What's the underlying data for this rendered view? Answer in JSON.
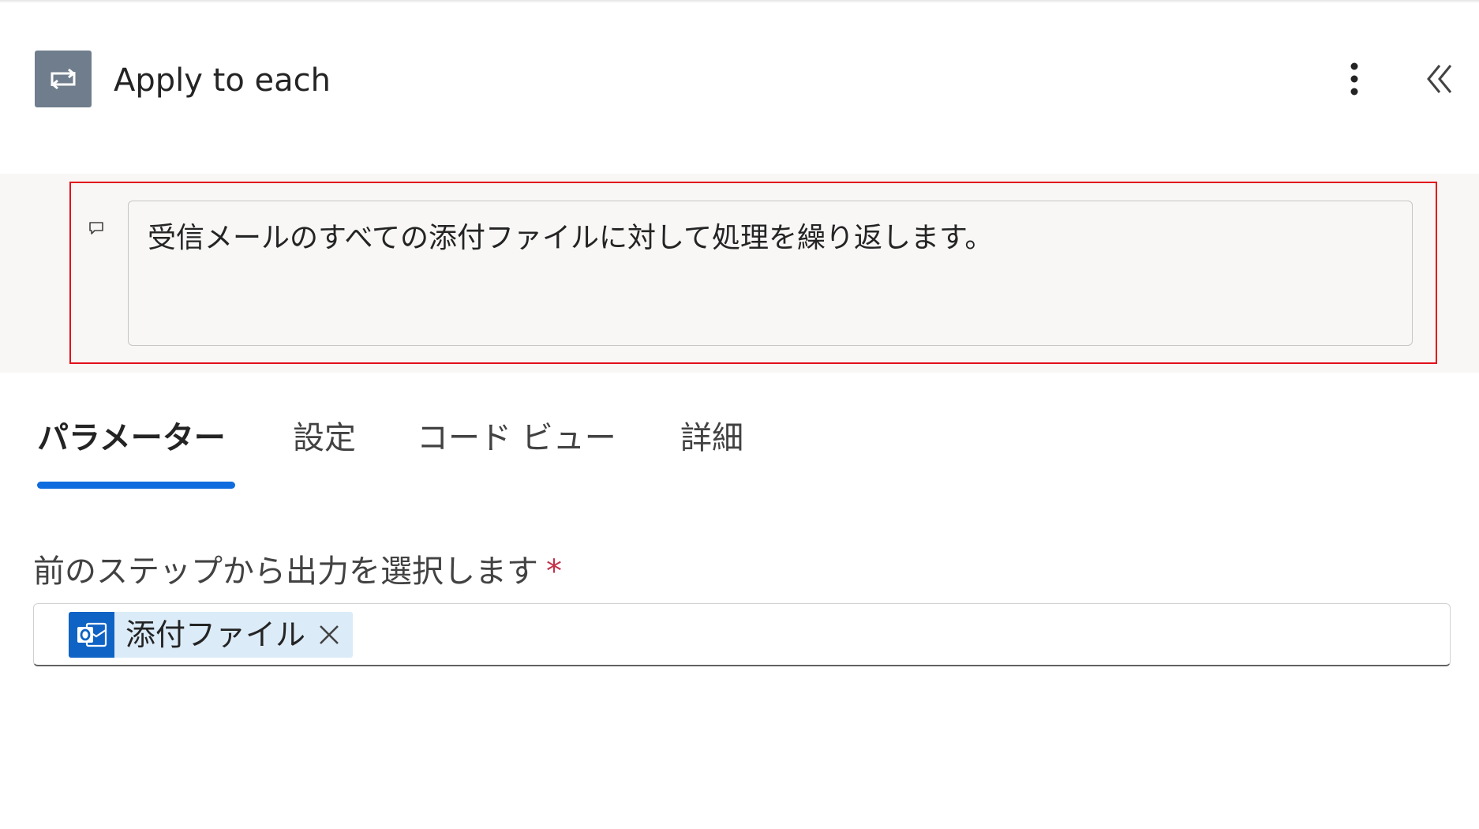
{
  "header": {
    "title": "Apply to each",
    "action_icon": "loop-icon",
    "more_icon": "more-vertical-icon",
    "collapse_icon": "double-chevron-left-icon"
  },
  "comment": {
    "icon": "comment-icon",
    "text": "受信メールのすべての添付ファイルに対して処理を繰り返します。"
  },
  "tabs": [
    {
      "label": "パラメーター",
      "active": true
    },
    {
      "label": "設定",
      "active": false
    },
    {
      "label": "コード ビュー",
      "active": false
    },
    {
      "label": "詳細",
      "active": false
    }
  ],
  "field": {
    "label": "前のステップから出力を選択します",
    "required_mark": "*",
    "token": {
      "label": "添付ファイル",
      "icon": "outlook-icon",
      "remove_icon": "close-icon"
    }
  },
  "colors": {
    "accent": "#0f6cde",
    "highlight_border": "#e3101a",
    "action_icon_bg": "#6f7d8c",
    "token_bg": "#dcebf8",
    "outlook_blue": "#0f63c4"
  }
}
